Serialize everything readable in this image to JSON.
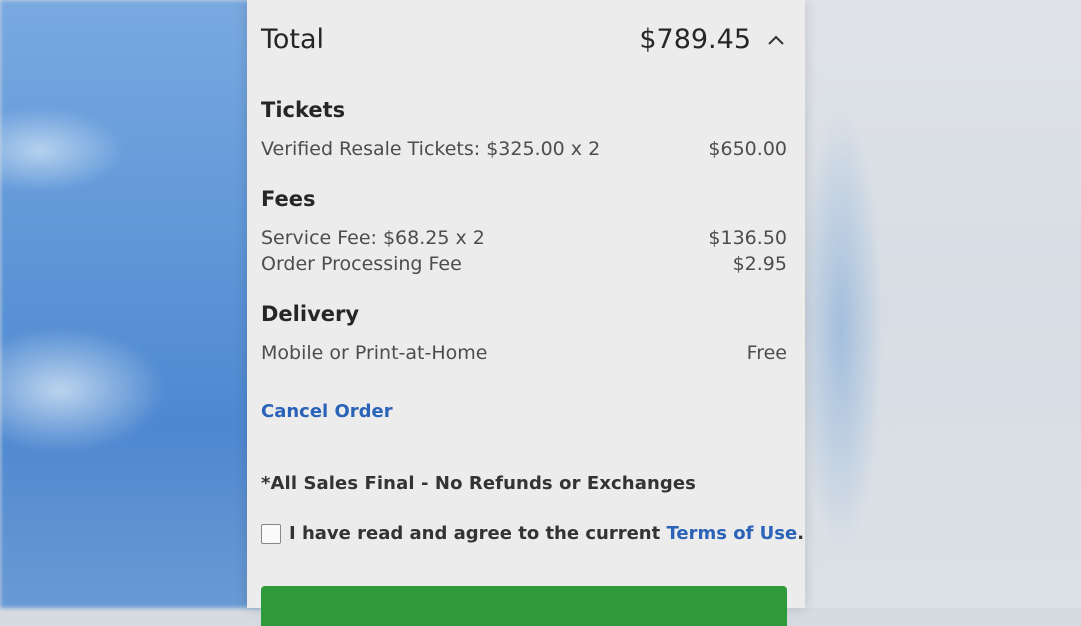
{
  "summary": {
    "total_label": "Total",
    "total_amount": "$789.45"
  },
  "tickets": {
    "heading": "Tickets",
    "line_label": "Verified Resale Tickets: $325.00 x 2",
    "line_amount": "$650.00"
  },
  "fees": {
    "heading": "Fees",
    "items": [
      {
        "label": "Service Fee: $68.25 x 2",
        "amount": "$136.50"
      },
      {
        "label": "Order Processing Fee",
        "amount": "$2.95"
      }
    ]
  },
  "delivery": {
    "heading": "Delivery",
    "method": "Mobile or Print-at-Home",
    "cost": "Free"
  },
  "actions": {
    "cancel_label": "Cancel Order",
    "sales_note": "*All Sales Final - No Refunds or Exchanges",
    "agree_text": "I have read and agree to the current",
    "terms_link": "Terms of Use",
    "terms_suffix": "."
  },
  "colors": {
    "link": "#2a63b8",
    "button": "#2e9a3a",
    "panel": "#ececec"
  },
  "icons": {
    "collapse": "chevron-up-icon"
  }
}
